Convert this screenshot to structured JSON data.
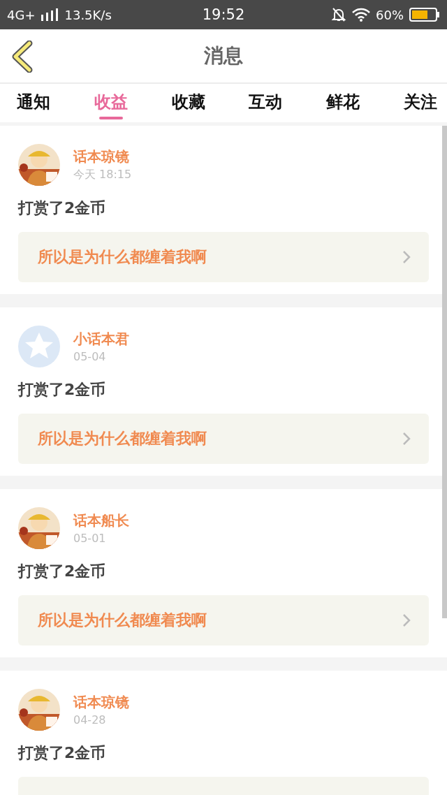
{
  "status_bar": {
    "network": "4G+",
    "speed": "13.5K/s",
    "time": "19:52",
    "battery": "60%"
  },
  "header": {
    "title": "消息"
  },
  "tabs": [
    {
      "label": "通知",
      "selected": false
    },
    {
      "label": "收益",
      "selected": true
    },
    {
      "label": "收藏",
      "selected": false
    },
    {
      "label": "互动",
      "selected": false
    },
    {
      "label": "鲜花",
      "selected": false
    },
    {
      "label": "关注",
      "selected": false
    }
  ],
  "messages": [
    {
      "user": "话本琼镜",
      "time": "今天 18:15",
      "text": "打赏了2金币",
      "work": "所以是为什么都缠着我啊"
    },
    {
      "user": "小话本君",
      "avatar": {
        "kind": "default"
      },
      "time": "05-04",
      "text": "打赏了2金币",
      "work": "所以是为什么都缠着我啊"
    },
    {
      "user": "话本船长",
      "time": "05-01",
      "text": "打赏了2金币",
      "work": "所以是为什么都缠着我啊"
    },
    {
      "user": "话本琼镜",
      "time": "04-28",
      "text": "打赏了2金币"
    }
  ]
}
